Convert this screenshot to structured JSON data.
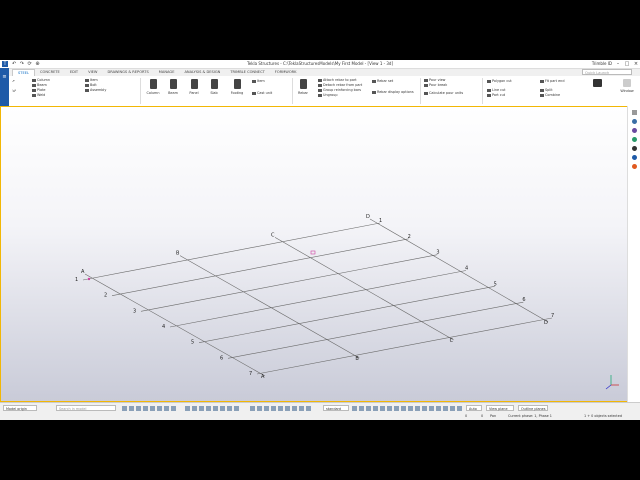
{
  "window": {
    "title": "Tekla Structures - C:\\TeklaStructuresModels\\My First Model - [View 1 - 3d]",
    "user": "Trimble ID",
    "logo": "T"
  },
  "quick_access": "↶ ↷ ⟳ ⊕",
  "tabs": [
    "STEEL",
    "CONCRETE",
    "EDIT",
    "VIEW",
    "DRAWINGS & REPORTS",
    "MANAGE",
    "ANALYSIS & DESIGN",
    "TRIMBLE CONNECT",
    "FORMWORK"
  ],
  "search_placeholder": "Quick Launch",
  "ribbon": {
    "small_left": [
      {
        "label": "Column"
      },
      {
        "label": "Beam"
      },
      {
        "label": "Plate"
      },
      {
        "label": "Weld"
      }
    ],
    "small_mid": [
      {
        "label": "Item"
      },
      {
        "label": "Bolt"
      },
      {
        "label": "Assembly"
      }
    ],
    "concrete_buttons": [
      {
        "label": "Column"
      },
      {
        "label": "Beam"
      },
      {
        "label": "Panel"
      },
      {
        "label": "Slab"
      },
      {
        "label": "Footing"
      }
    ],
    "cast": [
      {
        "label": "Item"
      },
      {
        "label": "Cast unit"
      }
    ],
    "rebar": {
      "big": "Rebar",
      "items": [
        "Attach rebar to part",
        "Detach rebar from part",
        "Group reinforcing bars",
        "Ungroup"
      ]
    },
    "rebar2": {
      "items": [
        "Rebar set",
        "Rebar display options"
      ]
    },
    "pour": {
      "items": [
        "Pour view",
        "Pour break",
        "Calculate pour units"
      ]
    },
    "poly": {
      "items": [
        "Polygon cut",
        "Line cut",
        "Part cut"
      ]
    },
    "fit": {
      "items": [
        "Fit part end",
        "Split",
        "Combine"
      ]
    },
    "window_label": "Window"
  },
  "grid": {
    "labels_abc": [
      "A",
      "B",
      "C",
      "D"
    ],
    "labels_num": [
      "1",
      "2",
      "3",
      "4",
      "5",
      "6",
      "7"
    ]
  },
  "status": {
    "left_select": "Model origin",
    "search_ph": "Search in model",
    "standard": "standard",
    "auto": "Auto",
    "view_plane": "View plane",
    "outline": "Outline planes",
    "coord_x": "0",
    "coord_y": "0",
    "pan": "Pan",
    "phase": "Current phase: 1, Phase 1",
    "selected": "1 + 0 objects selected"
  },
  "colors": {
    "accent": "#1e5aa8",
    "viewport_border": "#f2b705",
    "grid_line": "#6a6a6a"
  }
}
